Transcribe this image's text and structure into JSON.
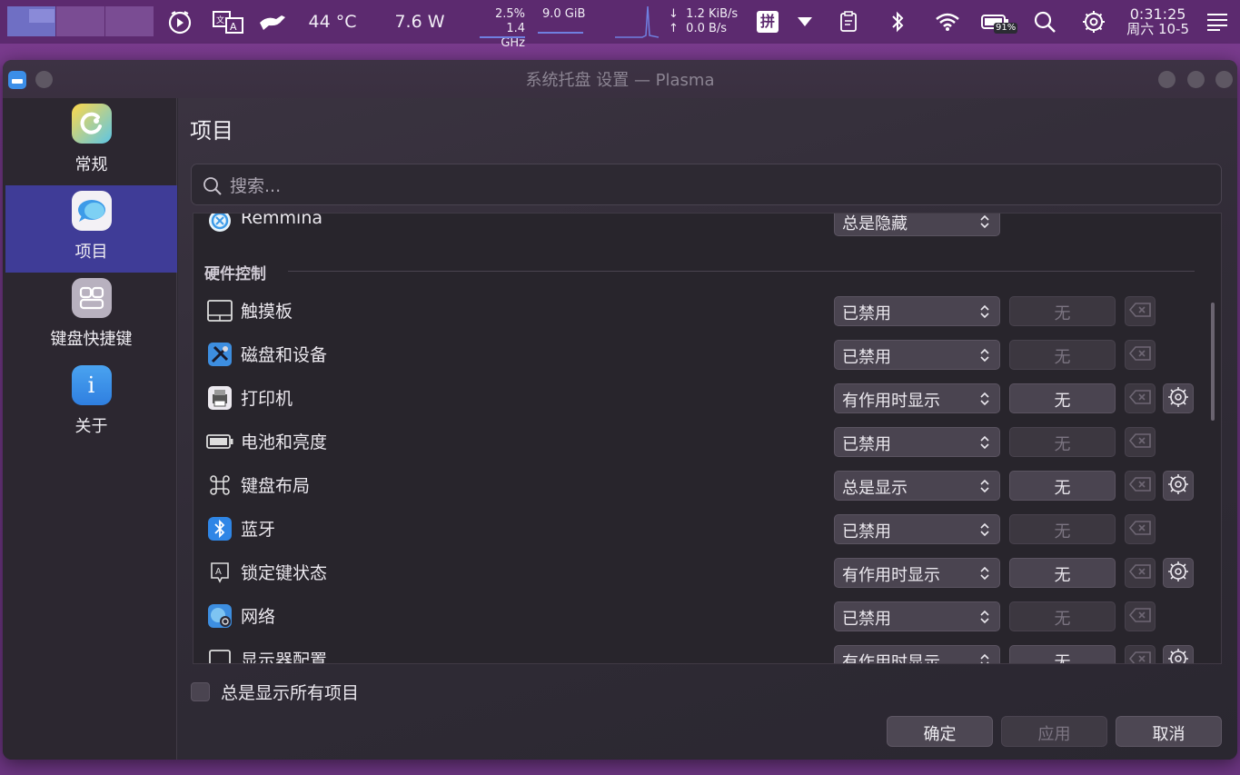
{
  "panel": {
    "temperature": "44 °C",
    "power": "7.6 W",
    "cpu_percent": "2.5%",
    "cpu_freq": "1.4 GHz",
    "memory": "9.0 GiB",
    "net_down": "1.2 KiB/s",
    "net_up": "0.0 B/s",
    "input_method": "拼",
    "battery": "91%",
    "time": "0:31:25",
    "date": "周六 10-5"
  },
  "window": {
    "title": "系统托盘 设置 — Plasma"
  },
  "sidebar": {
    "items": [
      {
        "label": "常规",
        "icon": "general-icon"
      },
      {
        "label": "项目",
        "icon": "entries-icon"
      },
      {
        "label": "键盘快捷键",
        "icon": "shortcuts-icon"
      },
      {
        "label": "关于",
        "icon": "about-icon"
      }
    ]
  },
  "main": {
    "title": "项目",
    "search_placeholder": "搜索...",
    "section_hardware": "硬件控制",
    "rows": [
      {
        "label": "Remmina",
        "visibility": "总是隐藏"
      },
      {
        "label": "触摸板",
        "visibility": "已禁用",
        "shortcut": "无"
      },
      {
        "label": "磁盘和设备",
        "visibility": "已禁用",
        "shortcut": "无"
      },
      {
        "label": "打印机",
        "visibility": "有作用时显示",
        "shortcut": "无"
      },
      {
        "label": "电池和亮度",
        "visibility": "已禁用",
        "shortcut": "无"
      },
      {
        "label": "键盘布局",
        "visibility": "总是显示",
        "shortcut": "无"
      },
      {
        "label": "蓝牙",
        "visibility": "已禁用",
        "shortcut": "无"
      },
      {
        "label": "锁定键状态",
        "visibility": "有作用时显示",
        "shortcut": "无"
      },
      {
        "label": "网络",
        "visibility": "已禁用",
        "shortcut": "无"
      },
      {
        "label": "显示器配置",
        "visibility": "有作用时显示",
        "shortcut": "无"
      }
    ],
    "show_all_label": "总是显示所有项目"
  },
  "buttons": {
    "ok": "确定",
    "apply": "应用",
    "cancel": "取消"
  },
  "colors": {
    "accent": "#3f3c97",
    "panel": "#5c2a6f"
  }
}
